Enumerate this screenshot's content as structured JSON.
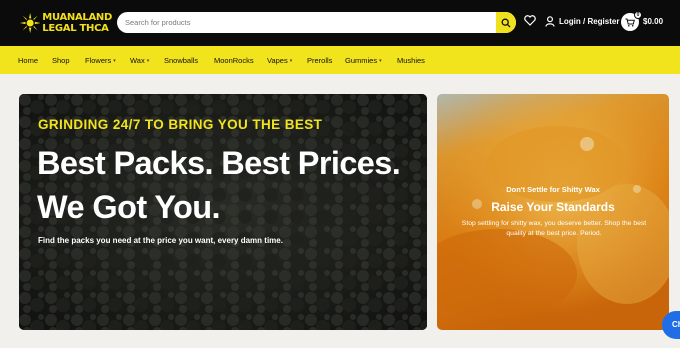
{
  "header": {
    "logo_line1": "MUANALAND",
    "logo_line2": "LEGAL THCA",
    "search_placeholder": "Search for products",
    "login_label": "Login / Register",
    "cart_count": "0",
    "cart_total": "$0.00"
  },
  "nav": {
    "items": [
      {
        "label": "Home"
      },
      {
        "label": "Shop"
      },
      {
        "label": "Flowers"
      },
      {
        "label": "Wax"
      },
      {
        "label": "Snowballs"
      },
      {
        "label": "MoonRocks"
      },
      {
        "label": "Vapes"
      },
      {
        "label": "Prerolls"
      },
      {
        "label": "Gummies"
      },
      {
        "label": "Mushies"
      }
    ]
  },
  "hero": {
    "kicker": "GRINDING 24/7 TO BRING YOU THE BEST",
    "headline_line1": "Best Packs. Best Prices.",
    "headline_line2": "We Got You.",
    "subtext": "Find the packs you need at the price you want, every damn time."
  },
  "promo": {
    "kicker": "Don't Settle for Shitty Wax",
    "title": "Raise Your Standards",
    "description": "Stop settling for shitty wax, you deserve better. Shop the best quality at the best price. Period."
  },
  "chat": {
    "label": "Ch"
  },
  "colors": {
    "brand_yellow": "#f1e31c",
    "header_black": "#0b0b0b",
    "chat_blue": "#1f6ee8"
  },
  "icons": [
    "search-icon",
    "heart-icon",
    "user-icon",
    "cart-icon",
    "chevron-down-icon"
  ]
}
